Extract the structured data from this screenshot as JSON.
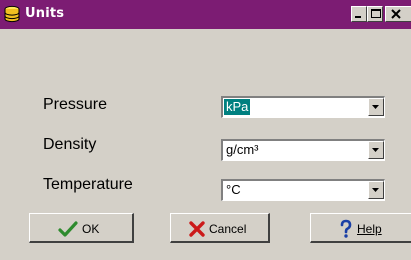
{
  "window": {
    "title": "Units",
    "icon": "database-icon",
    "controls": {
      "minimize": "minimize-icon",
      "maximize": "maximize-icon",
      "close": "close-icon"
    }
  },
  "fields": [
    {
      "label": "Pressure",
      "value": "kPa",
      "selected": true
    },
    {
      "label": "Density",
      "value": "g/cm³",
      "selected": false
    },
    {
      "label": "Temperature",
      "value": "°C",
      "selected": false
    }
  ],
  "buttons": {
    "ok": {
      "label": "OK",
      "icon": "checkmark-icon",
      "icon_color": "#2e8b2e"
    },
    "cancel": {
      "label": "Cancel",
      "icon": "x-icon",
      "icon_color": "#cc1a1a"
    },
    "help": {
      "label": "Help",
      "icon": "question-icon",
      "icon_color": "#1a3fa6"
    }
  },
  "colors": {
    "titlebar": "#7c1c73",
    "face": "#d4d0c8",
    "selection": "#008080"
  }
}
